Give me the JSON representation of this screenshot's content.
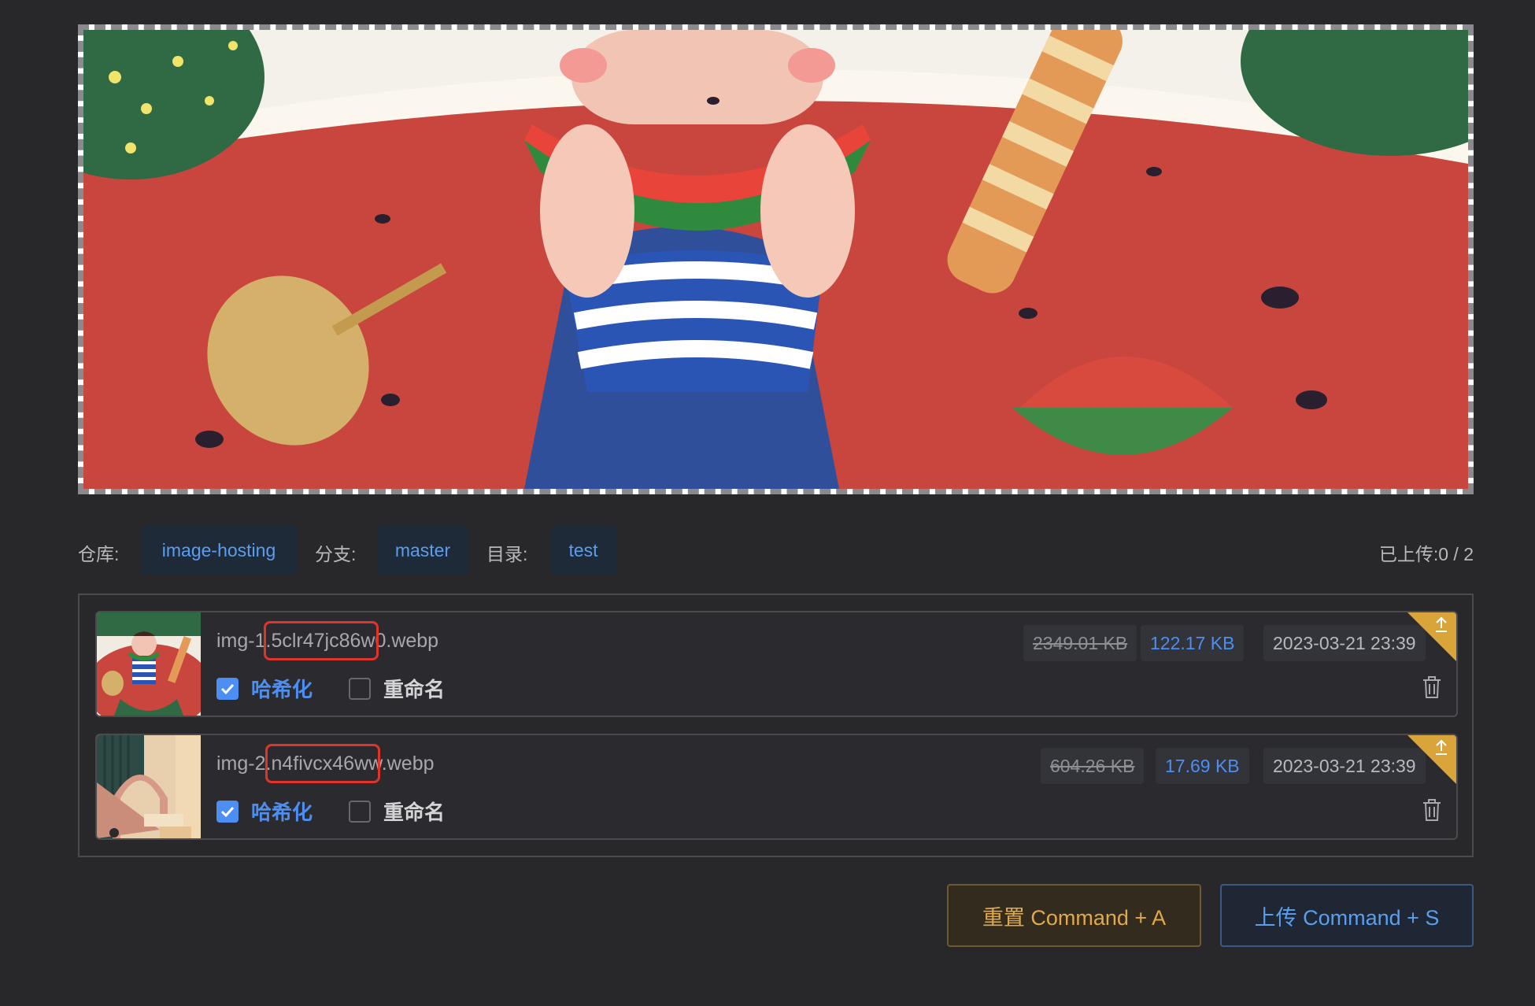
{
  "repo_bar": {
    "repo_label": "仓库:",
    "repo_value": "image-hosting",
    "branch_label": "分支:",
    "branch_value": "master",
    "dir_label": "目录:",
    "dir_value": "test",
    "upload_status": "已上传:0 / 2"
  },
  "files": [
    {
      "name": "img-1.5clr47jc86w0.webp",
      "hash_label": "哈希化",
      "hash_checked": true,
      "rename_label": "重命名",
      "rename_checked": false,
      "original_size": "2349.01 KB",
      "compressed_size": "122.17 KB",
      "date": "2023-03-21 23:39"
    },
    {
      "name": "img-2.n4fivcx46ww.webp",
      "hash_label": "哈希化",
      "hash_checked": true,
      "rename_label": "重命名",
      "rename_checked": false,
      "original_size": "604.26 KB",
      "compressed_size": "17.69 KB",
      "date": "2023-03-21 23:39"
    }
  ],
  "actions": {
    "reset_label": "重置 Command + A",
    "upload_label": "上传 Command + S"
  },
  "colors": {
    "accent": "#4d8ef2",
    "reset": "#e0a94a",
    "upload_corner": "#d9a53b",
    "highlight": "#e0332a"
  },
  "icons": {
    "checkbox": "check-icon",
    "upload_corner": "upload-icon",
    "delete": "trash-icon"
  }
}
